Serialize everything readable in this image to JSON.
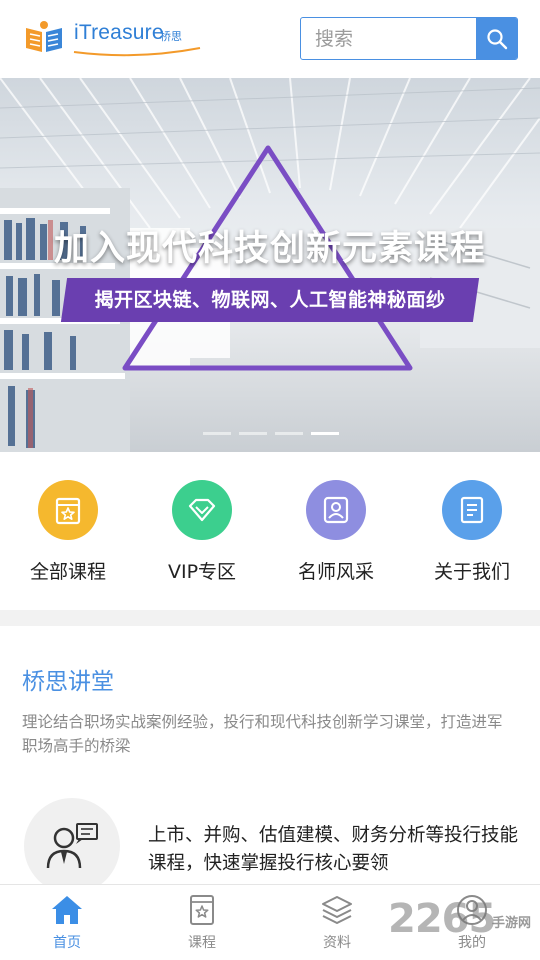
{
  "header": {
    "logo_text": "iTreasure",
    "logo_sub": "桥思",
    "search_placeholder": "搜索"
  },
  "banner": {
    "title": "加入现代科技创新元素课程",
    "subtitle": "揭开区块链、物联网、人工智能神秘面纱",
    "slide_count": 4,
    "active_slide": 4
  },
  "quick_nav": [
    {
      "label": "全部课程",
      "icon": "course-calendar-icon",
      "color": "#f5b82e"
    },
    {
      "label": "VIP专区",
      "icon": "diamond-icon",
      "color": "#3ccf8e"
    },
    {
      "label": "名师风采",
      "icon": "teacher-portrait-icon",
      "color": "#8e8ee0"
    },
    {
      "label": "关于我们",
      "icon": "document-icon",
      "color": "#5aa0ea"
    }
  ],
  "lecture": {
    "title": "桥思讲堂",
    "description": "理论结合职场实战案例经验，投行和现代科技创新学习课堂，打造进军职场高手的桥梁",
    "feature_text": "上市、并购、估值建模、财务分析等投行技能课程，快速掌握投行核心要领"
  },
  "tabbar": [
    {
      "label": "首页",
      "icon": "home-icon",
      "active": true
    },
    {
      "label": "课程",
      "icon": "course-book-icon",
      "active": false
    },
    {
      "label": "资料",
      "icon": "layers-icon",
      "active": false
    },
    {
      "label": "我的",
      "icon": "user-icon",
      "active": false
    }
  ],
  "watermark": {
    "number": "2265",
    "text": "手游网"
  },
  "colors": {
    "accent": "#4a90e2",
    "banner_purple": "#6a3fb0"
  }
}
